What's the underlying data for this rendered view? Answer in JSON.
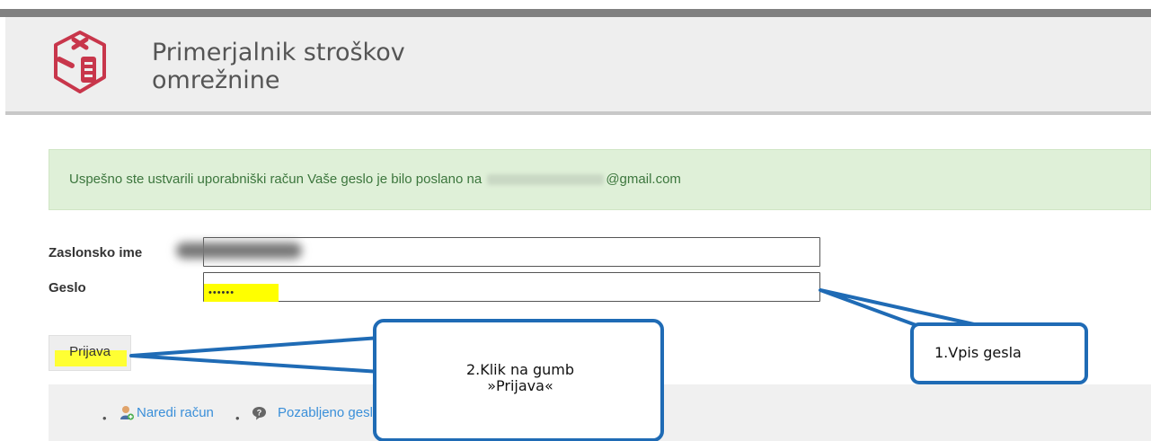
{
  "header": {
    "title_line1": "Primerjalnik stroškov",
    "title_line2": "omrežnine",
    "logo_color": "#c8364b"
  },
  "alert": {
    "message_start": "Uspešno ste ustvarili uporabniški račun Vaše geslo je bilo poslano na",
    "email_domain": "@gmail.com"
  },
  "form": {
    "username_label": "Zaslonsko ime",
    "password_label": "Geslo",
    "password_value": "••••••",
    "submit_label": "Prijava"
  },
  "links": {
    "create_account": "Naredi račun",
    "forgot_password": "Pozabljeno geslo"
  },
  "annotations": {
    "step1": "1.Vpis gesla",
    "step2_line1": "2.Klik na gumb",
    "step2_line2": "»Prijava«",
    "callout_color": "#1f6bb5",
    "highlight_color": "#ffff00"
  }
}
